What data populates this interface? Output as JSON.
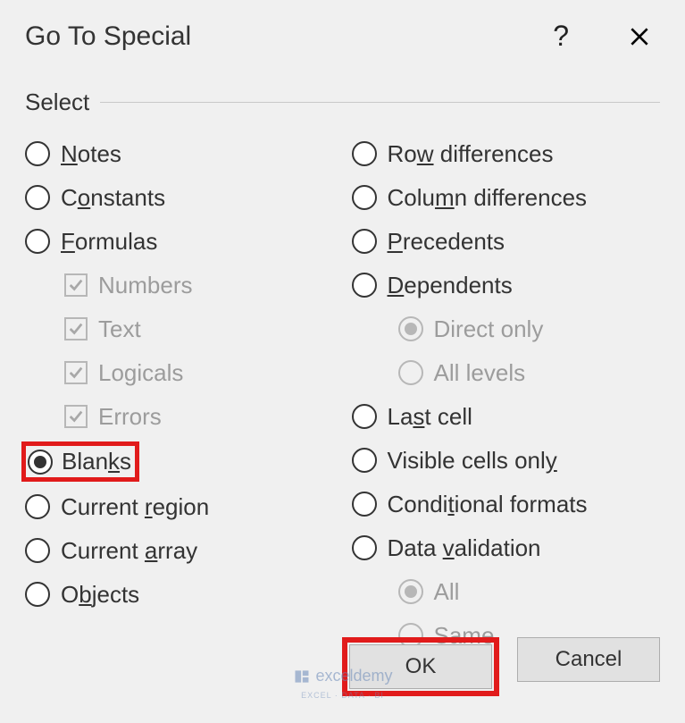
{
  "dialog": {
    "title": "Go To Special",
    "group_label": "Select"
  },
  "left": {
    "notes": {
      "pre": "",
      "u": "N",
      "post": "otes"
    },
    "constants": {
      "pre": "C",
      "u": "o",
      "post": "nstants"
    },
    "formulas": {
      "pre": "",
      "u": "F",
      "post": "ormulas"
    },
    "numbers": "Numbers",
    "text": "Text",
    "logicals": "Logicals",
    "errors": "Errors",
    "blanks": {
      "pre": "Blan",
      "u": "k",
      "post": "s"
    },
    "current_region": {
      "pre": "Current ",
      "u": "r",
      "post": "egion"
    },
    "current_array": {
      "pre": "Current ",
      "u": "a",
      "post": "rray"
    },
    "objects": {
      "pre": "O",
      "u": "b",
      "post": "jects"
    }
  },
  "right": {
    "row_diff": {
      "pre": "Ro",
      "u": "w",
      "post": " differences"
    },
    "col_diff": {
      "pre": "Colu",
      "u": "m",
      "post": "n differences"
    },
    "precedents": {
      "pre": "",
      "u": "P",
      "post": "recedents"
    },
    "dependents": {
      "pre": "",
      "u": "D",
      "post": "ependents"
    },
    "direct_only": "Direct only",
    "all_levels": "All levels",
    "last_cell": {
      "pre": "La",
      "u": "s",
      "post": "t cell"
    },
    "visible": {
      "pre": "Visible cells onl",
      "u": "y",
      "post": ""
    },
    "cond_fmt": {
      "pre": "Condi",
      "u": "t",
      "post": "ional formats"
    },
    "data_val": {
      "pre": "Data ",
      "u": "v",
      "post": "alidation"
    },
    "all": "All",
    "same": "Same"
  },
  "buttons": {
    "ok": "OK",
    "cancel": "Cancel"
  },
  "watermark": {
    "brand": "exceldemy",
    "sub": "EXCEL · DATA · BI"
  }
}
